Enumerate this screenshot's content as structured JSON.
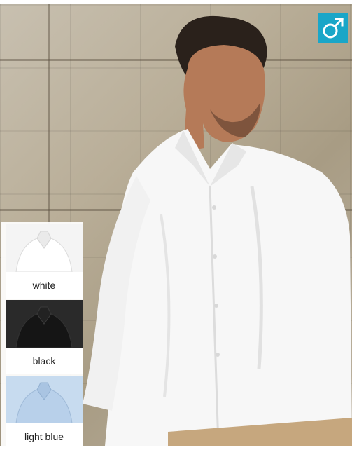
{
  "product": {
    "gender_icon": "male-symbol-icon",
    "badge_color": "#1aa6c8"
  },
  "colors": [
    {
      "label": "white",
      "swatch": "#f4f4f4"
    },
    {
      "label": "black",
      "swatch": "#1b1b1b"
    },
    {
      "label": "light blue",
      "swatch": "#bcd3ea"
    }
  ]
}
